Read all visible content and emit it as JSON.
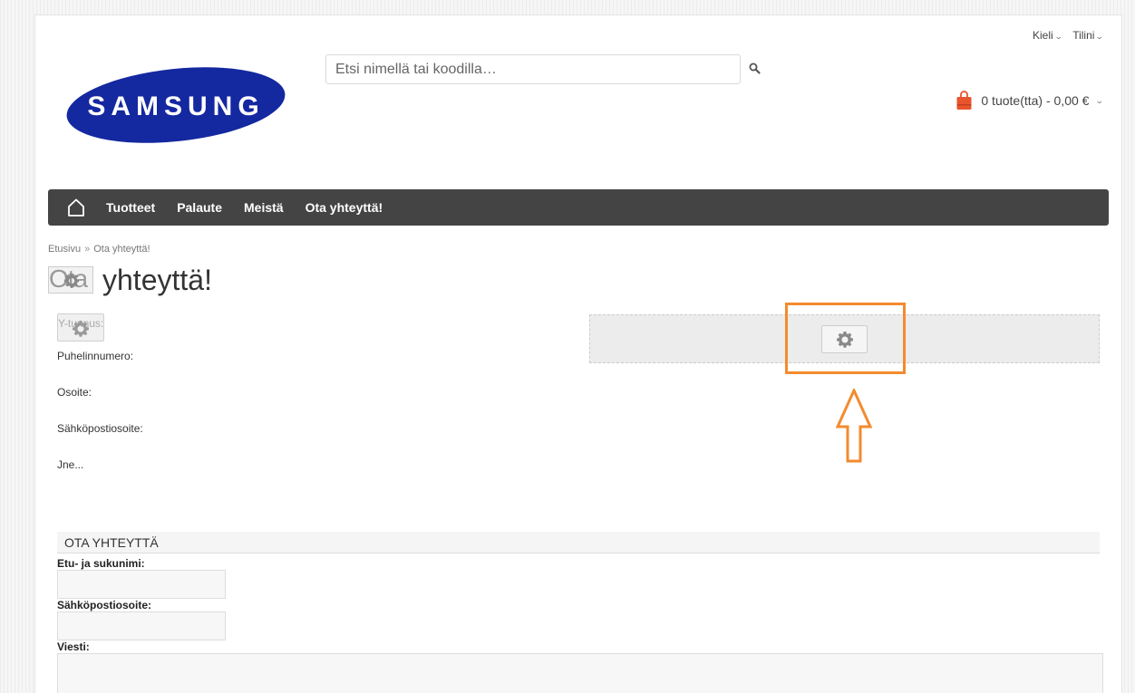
{
  "header": {
    "logo_text": "SAMSUNG",
    "search_placeholder": "Etsi nimellä tai koodilla…",
    "language_label": "Kieli",
    "account_label": "Tilini",
    "cart_summary": "0 tuote(tta) - 0,00 €"
  },
  "nav": {
    "items": [
      {
        "label": "Tuotteet"
      },
      {
        "label": "Palaute"
      },
      {
        "label": "Meistä"
      },
      {
        "label": "Ota yhteyttä!"
      }
    ]
  },
  "breadcrumb": {
    "home": "Etusivu",
    "separator": "»",
    "current": "Ota yhteyttä!"
  },
  "page": {
    "title_img_alt": "Ota",
    "title": "yhteyttä!"
  },
  "contact_info": {
    "business_id_label": "Y-tunnus:",
    "phone_label": "Puhelinnumero:",
    "address_label": "Osoite:",
    "email_label": "Sähköpostiosoite:",
    "etc_label": "Jne..."
  },
  "form": {
    "heading": "OTA YHTEYTTÄ",
    "name_label": "Etu- ja sukunimi:",
    "email_label": "Sähköpostiosoite:",
    "message_label": "Viesti:"
  },
  "colors": {
    "nav_bg": "#444444",
    "highlight": "#f38b2f",
    "logo_blue": "#1428a0",
    "cart_icon": "#e8542e"
  }
}
